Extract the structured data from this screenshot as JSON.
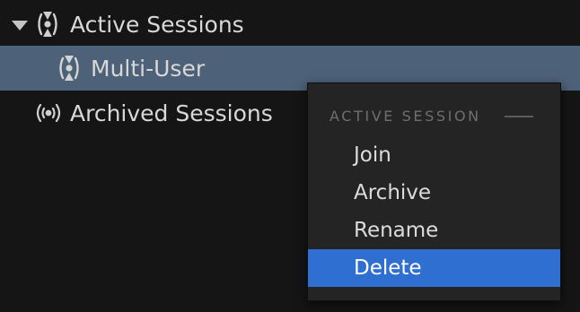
{
  "tree": {
    "active_sessions_label": "Active Sessions",
    "multi_user_label": "Multi-User",
    "archived_sessions_label": "Archived Sessions",
    "active_icon": "session-broadcast-icon",
    "archived_icon": "archived-broadcast-icon"
  },
  "context_menu": {
    "header": "ACTIVE SESSION",
    "items": [
      {
        "label": "Join"
      },
      {
        "label": "Archive"
      },
      {
        "label": "Rename"
      },
      {
        "label": "Delete"
      }
    ],
    "highlighted_item": "Delete"
  },
  "colors": {
    "background": "#151515",
    "selected_row": "#4d6178",
    "menu_background": "#242424",
    "menu_highlight": "#2f6fd1"
  }
}
